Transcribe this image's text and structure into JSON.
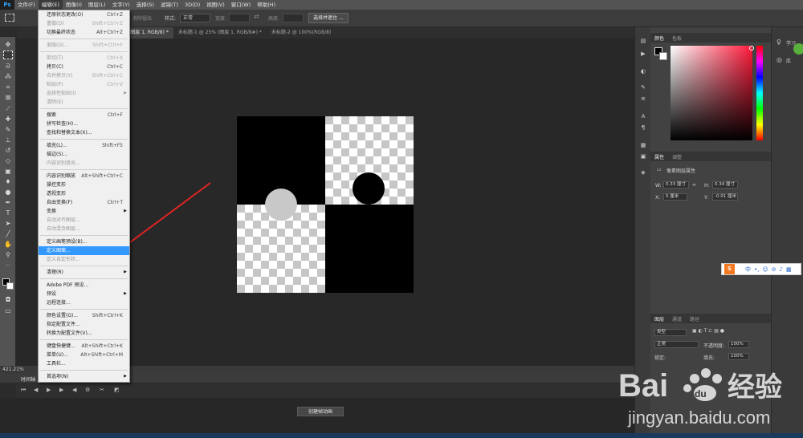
{
  "menubar": {
    "logo": "Ps",
    "items": [
      "文件(F)",
      "编辑(E)",
      "图像(I)",
      "图层(L)",
      "文字(Y)",
      "选择(S)",
      "滤镜(T)",
      "3D(D)",
      "视图(V)",
      "窗口(W)",
      "帮助(H)"
    ]
  },
  "options_bar": {
    "feather_label": "消除锯齿",
    "style_label": "样式:",
    "style_value": "正常",
    "width_label": "宽度:",
    "height_label": "高度:",
    "select_mask_button": "选择并遮住 ..."
  },
  "tabs": [
    {
      "label": "未标 (99"
    },
    {
      "label": "421% (图层 1, RGB/8) *"
    },
    {
      "label": "未标题-1 @ 25% (图层 1, RGB/8#) *"
    },
    {
      "label": "未标题-2 @ 100%(RGB/8)"
    }
  ],
  "status": {
    "zoom": "421.21%"
  },
  "timeline": {
    "tab": "时间轴",
    "create_button": "创建帧动画"
  },
  "panels": {
    "color": {
      "tab1": "颜色",
      "tab2": "色板"
    },
    "properties": {
      "tab1": "属性",
      "tab2": "调整",
      "title": "像素图层属性",
      "w_label": "W:",
      "w_value": "0.33 厘寸",
      "h_label": "H:",
      "h_value": "0.34 厘寸",
      "x_label": "X:",
      "x_value": "0 厘米",
      "y_label": "Y:",
      "y_value": "-0.01 厘米"
    },
    "layers": {
      "tab1": "图层",
      "tab2": "通道",
      "tab3": "路径",
      "kind": "类型",
      "blend": "正常",
      "opacity_label": "不透明度:",
      "opacity": "100%",
      "lock_label": "锁定:",
      "fill_label": "填充:",
      "fill": "100%"
    }
  },
  "far_right": {
    "learn": "学习",
    "lib": "库"
  },
  "ime": {
    "logo": "S",
    "lang": "中"
  },
  "watermark": {
    "brand": "Bai",
    "brand2": "du",
    "cn": "经验",
    "url": "jingyan.baidu.com"
  },
  "edit_menu": {
    "items": [
      {
        "label": "还原状态更改(O)",
        "shortcut": "Ctrl+Z",
        "disabled": false
      },
      {
        "label": "重做(O)",
        "shortcut": "Shift+Ctrl+Z",
        "disabled": true
      },
      {
        "label": "切换最终状态",
        "shortcut": "Alt+Ctrl+Z",
        "disabled": false
      },
      {
        "sep": true
      },
      {
        "label": "渐隐(D)...",
        "shortcut": "Shift+Ctrl+F",
        "disabled": true
      },
      {
        "sep": true
      },
      {
        "label": "剪切(T)",
        "shortcut": "Ctrl+X",
        "disabled": true
      },
      {
        "label": "拷贝(C)",
        "shortcut": "Ctrl+C",
        "disabled": false
      },
      {
        "label": "合并拷贝(Y)",
        "shortcut": "Shift+Ctrl+C",
        "disabled": true
      },
      {
        "label": "粘贴(P)",
        "shortcut": "Ctrl+V",
        "disabled": true
      },
      {
        "label": "选择性粘贴(I)",
        "shortcut": "",
        "disabled": true,
        "submenu": true
      },
      {
        "label": "清除(E)",
        "shortcut": "",
        "disabled": true
      },
      {
        "sep": true
      },
      {
        "label": "搜索",
        "shortcut": "Ctrl+F",
        "disabled": false
      },
      {
        "label": "拼写检查(H)...",
        "shortcut": "",
        "disabled": false
      },
      {
        "label": "查找和替换文本(X)...",
        "shortcut": "",
        "disabled": false
      },
      {
        "sep": true
      },
      {
        "label": "填充(L)...",
        "shortcut": "Shift+F5",
        "disabled": false
      },
      {
        "label": "描边(S)...",
        "shortcut": "",
        "disabled": false
      },
      {
        "label": "内容识别填充...",
        "shortcut": "",
        "disabled": true
      },
      {
        "sep": true
      },
      {
        "label": "内容识别缩放",
        "shortcut": "Alt+Shift+Ctrl+C",
        "disabled": false
      },
      {
        "label": "操控变形",
        "shortcut": "",
        "disabled": false
      },
      {
        "label": "透视变形",
        "shortcut": "",
        "disabled": false
      },
      {
        "label": "自由变换(F)",
        "shortcut": "Ctrl+T",
        "disabled": false
      },
      {
        "label": "变换",
        "shortcut": "",
        "disabled": false,
        "submenu": true
      },
      {
        "label": "自动对齐图层...",
        "shortcut": "",
        "disabled": true
      },
      {
        "label": "自动混合图层...",
        "shortcut": "",
        "disabled": true
      },
      {
        "sep": true
      },
      {
        "label": "定义画笔预设(B)...",
        "shortcut": "",
        "disabled": false
      },
      {
        "label": "定义图案...",
        "shortcut": "",
        "disabled": false,
        "highlight": true
      },
      {
        "label": "定义自定形状...",
        "shortcut": "",
        "disabled": true
      },
      {
        "sep": true
      },
      {
        "label": "清理(R)",
        "shortcut": "",
        "disabled": false,
        "submenu": true
      },
      {
        "sep": true
      },
      {
        "label": "Adobe PDF 预设...",
        "shortcut": "",
        "disabled": false
      },
      {
        "label": "预设",
        "shortcut": "",
        "disabled": false,
        "submenu": true
      },
      {
        "label": "远程连接...",
        "shortcut": "",
        "disabled": false
      },
      {
        "sep": true
      },
      {
        "label": "颜色设置(G)...",
        "shortcut": "Shift+Ctrl+K",
        "disabled": false
      },
      {
        "label": "指定配置文件...",
        "shortcut": "",
        "disabled": false
      },
      {
        "label": "转换为配置文件(V)...",
        "shortcut": "",
        "disabled": false
      },
      {
        "sep": true
      },
      {
        "label": "键盘快捷键...",
        "shortcut": "Alt+Shift+Ctrl+K",
        "disabled": false
      },
      {
        "label": "菜单(U)...",
        "shortcut": "Alt+Shift+Ctrl+M",
        "disabled": false
      },
      {
        "label": "工具栏...",
        "shortcut": "",
        "disabled": false
      },
      {
        "sep": true
      },
      {
        "label": "首选项(N)",
        "shortcut": "",
        "disabled": false,
        "submenu": true
      }
    ]
  },
  "icons": [
    "move-icon",
    "marquee-icon",
    "lasso-icon",
    "magic-wand-icon",
    "crop-icon",
    "eyedropper-icon",
    "brush-icon",
    "stamp-icon",
    "eraser-icon",
    "gradient-icon",
    "pen-icon",
    "type-icon",
    "path-select-icon",
    "shape-icon",
    "hand-icon",
    "zoom-icon"
  ]
}
